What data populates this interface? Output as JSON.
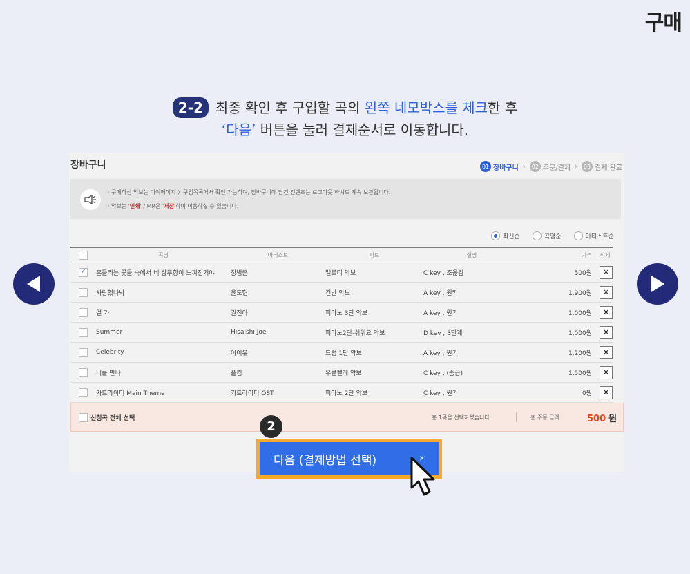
{
  "corner_title": "구매",
  "instruction": {
    "step": "2-2",
    "line1_a": "최종 확인 후 구입할 곡의 ",
    "line1_hl": "왼쪽 네모박스를 체크",
    "line1_b": "한 후",
    "line2_hl": "‘다음’",
    "line2_b": " 버튼을 눌러 결제순서로 이동합니다."
  },
  "cart": {
    "title": "장바구니",
    "steps": [
      {
        "num": "01",
        "label": "장바구니"
      },
      {
        "num": "02",
        "label": "주문/결제"
      },
      {
        "num": "03",
        "label": "결제 완료"
      }
    ],
    "notice": {
      "line1": "구매하신 악보는 마이페이지 〉구입목록에서 확인 가능하며, 장바구니에 담긴 컨텐츠는 로그아웃 하셔도 계속 보관됩니다.",
      "line2_a": "악보는 '",
      "line2_red1": "인쇄",
      "line2_b": "' / MR은 '",
      "line2_red2": "저장",
      "line2_c": "'하여 이용하실 수 있습니다."
    },
    "sort": [
      "최신순",
      "곡명순",
      "아티스트순"
    ],
    "headers": {
      "title": "곡명",
      "artist": "아티스트",
      "part": "파트",
      "desc": "설명",
      "price": "가격",
      "delete": "삭제"
    },
    "rows": [
      {
        "title": "흔들리는 꽃들 속에서 네 샴푸향이 느껴진거야",
        "artist": "장범준",
        "part": "멜로디 악보",
        "desc": "C key , 조옮김",
        "price": "500원",
        "checked": true
      },
      {
        "title": "사랑했나봐",
        "artist": "윤도현",
        "part": "건반 악보",
        "desc": "A key , 원키",
        "price": "1,900원",
        "checked": false
      },
      {
        "title": "걸 가",
        "artist": "권진아",
        "part": "피아노 3단 악보",
        "desc": "A key , 원키",
        "price": "1,000원",
        "checked": false
      },
      {
        "title": "Summer",
        "artist": "Hisaishi Joe",
        "part": "피아노2단-쉬워요 악보",
        "desc": "D key , 3단계",
        "price": "1,000원",
        "checked": false
      },
      {
        "title": "Celebrity",
        "artist": "아이유",
        "part": "드럼 1단 악보",
        "desc": "A key , 원키",
        "price": "1,200원",
        "checked": false
      },
      {
        "title": "너를 만나",
        "artist": "폴킴",
        "part": "우쿨렐레 악보",
        "desc": "C key , (중급)",
        "price": "1,500원",
        "checked": false
      },
      {
        "title": "카트라이더 Main Theme",
        "artist": "카트라이더 OST",
        "part": "피아노 2단 악보",
        "desc": "C key , 원키",
        "price": "0원",
        "checked": false
      }
    ],
    "footer": {
      "select_all": "신청곡 전체 선택",
      "count_text": "총 1곡을 선택하셨습니다.",
      "total_label": "총 주문 금액",
      "total_value": "500",
      "total_unit": "원"
    }
  },
  "callout_number": "2",
  "next_button": "다음 (결제방법 선택)",
  "colors": {
    "accent": "#2f5fd9",
    "nav": "#232a78",
    "highlight_border": "#f5aa2c",
    "total": "#e2461c"
  }
}
